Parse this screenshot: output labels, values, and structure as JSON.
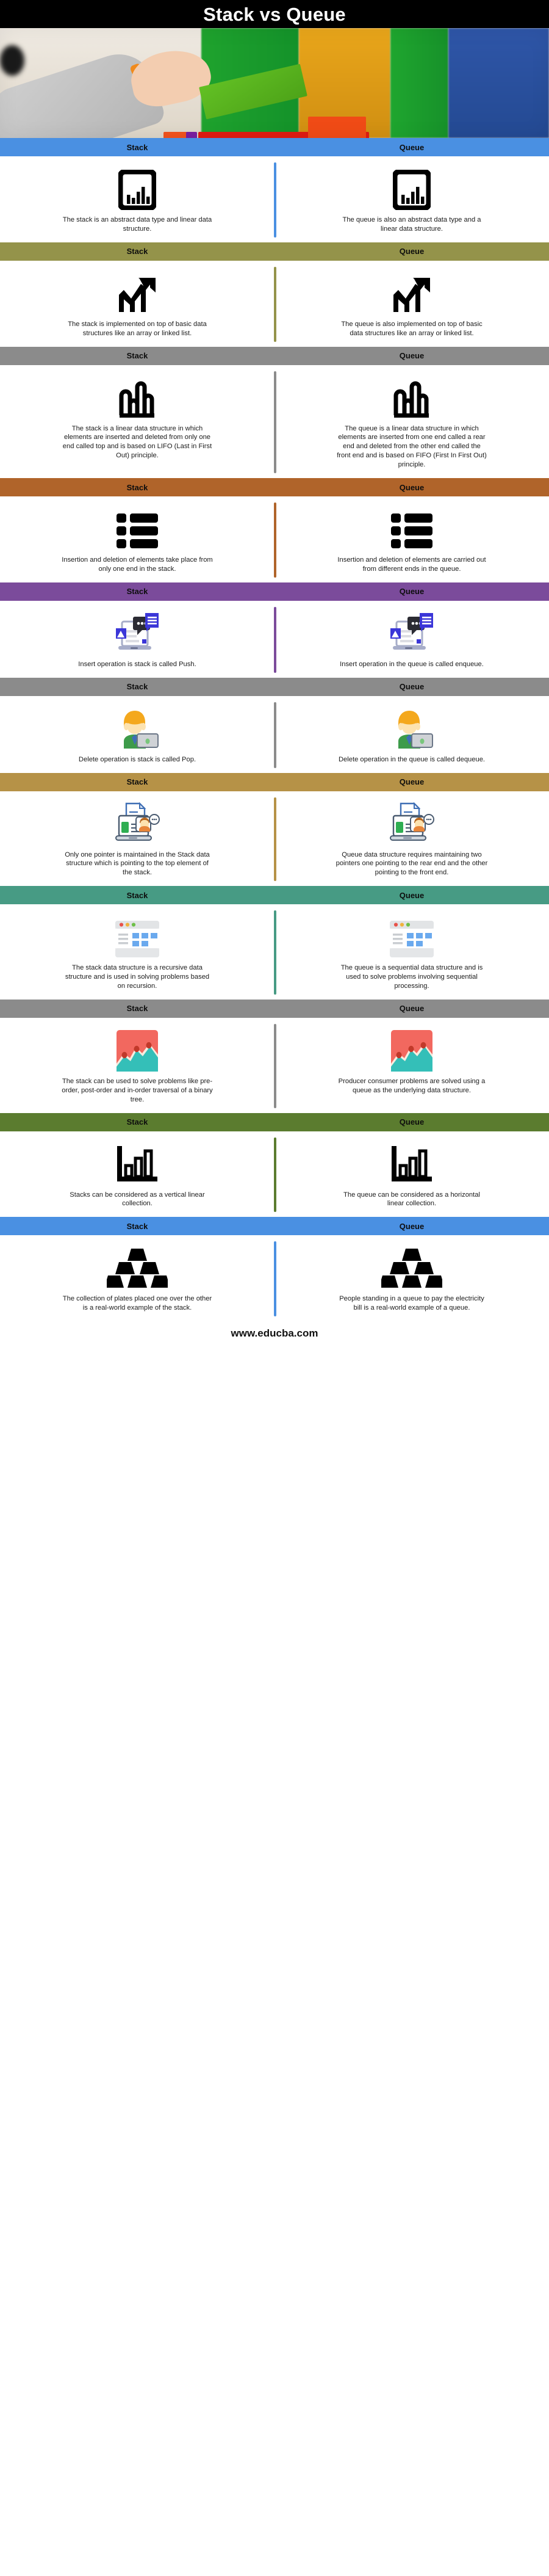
{
  "title": "Stack vs Queue",
  "hero": {
    "alt": "child-stacking-wooden-blocks-photo"
  },
  "columns": {
    "left": "Stack",
    "right": "Queue"
  },
  "footer": {
    "url": "www.educba.com"
  },
  "colors": {
    "title_bg": "#000000",
    "blue": "#4a90e2",
    "olive": "#94934a",
    "gray": "#8b8b8b",
    "brown": "#b0642a",
    "purple": "#7b4b9b",
    "tan": "#b69247",
    "teal": "#479b84",
    "darkgreen": "#5b7c2f",
    "text": "#1a1a1a"
  },
  "rows": [
    {
      "band_color": "#4a90e2",
      "left_label": "Stack",
      "right_label": "Queue",
      "icon": "bar-chart-framed-icon",
      "left_text": "The stack is an abstract data type and linear data structure.",
      "right_text": "The queue is also an abstract data type and a linear data structure."
    },
    {
      "band_color": "#94934a",
      "left_label": "Stack",
      "right_label": "Queue",
      "icon": "growth-arrow-chart-icon",
      "left_text": "The stack is implemented on top of basic data structures like an array or linked list.",
      "right_text": "The queue is also implemented on top of basic data structures like an array or linked list."
    },
    {
      "band_color": "#8b8b8b",
      "left_label": "Stack",
      "right_label": "Queue",
      "icon": "outline-bar-chart-icon",
      "left_text": "The stack is a linear data structure in which elements are inserted and deleted from only one end called top and is based on LIFO (Last in First Out) principle.",
      "right_text": "The queue is a linear data structure in which elements are inserted from one end called a rear end and deleted from the other end called the front end and is based on FIFO (First In First Out) principle."
    },
    {
      "band_color": "#b0642a",
      "left_label": "Stack",
      "right_label": "Queue",
      "icon": "list-rows-icon",
      "left_text": "Insertion and deletion of elements take place from only one end in the stack.",
      "right_text": "Insertion and deletion of elements are carried out from different ends in the queue."
    },
    {
      "band_color": "#7b4b9b",
      "left_label": "Stack",
      "right_label": "Queue",
      "icon": "laptop-chat-message-icon",
      "left_text": "Insert operation is stack is called Push.",
      "right_text": "Insert operation in the queue is called enqueue."
    },
    {
      "band_color": "#8b8b8b",
      "left_label": "Stack",
      "right_label": "Queue",
      "icon": "person-with-laptop-icon",
      "left_text": "Delete operation is stack is called Pop.",
      "right_text": "Delete operation in the queue is called dequeue."
    },
    {
      "band_color": "#b69247",
      "left_label": "Stack",
      "right_label": "Queue",
      "icon": "laptop-document-person-icon",
      "left_text": "Only one pointer is maintained in the Stack data structure which is pointing to the top element of the stack.",
      "right_text": "Queue data structure requires maintaining two pointers one pointing to the rear end and the other pointing to the front end."
    },
    {
      "band_color": "#479b84",
      "left_label": "Stack",
      "right_label": "Queue",
      "icon": "browser-window-icon",
      "left_text": "The stack data structure is a recursive data structure and is used in solving problems based on recursion.",
      "right_text": "The queue is a sequential data structure and is used to solve problems involving sequential processing."
    },
    {
      "band_color": "#8b8b8b",
      "left_label": "Stack",
      "right_label": "Queue",
      "icon": "mountain-landscape-icon",
      "left_text": "The stack can be used to solve problems like pre-order, post-order and in-order traversal of a binary tree.",
      "right_text": "Producer consumer problems are solved using a queue as the underlying data structure."
    },
    {
      "band_color": "#5b7c2f",
      "left_label": "Stack",
      "right_label": "Queue",
      "icon": "axis-bar-chart-icon",
      "left_text": "Stacks can be considered as a vertical linear collection.",
      "right_text": "The queue can be considered as a horizontal linear collection."
    },
    {
      "band_color": "#4a90e2",
      "left_label": "Stack",
      "right_label": "Queue",
      "icon": "stacked-plates-pyramid-icon",
      "left_text": "The collection of plates placed one over the other is a real-world example of the stack.",
      "right_text": "People standing in a queue to pay the electricity bill is a real-world example of a queue."
    }
  ]
}
